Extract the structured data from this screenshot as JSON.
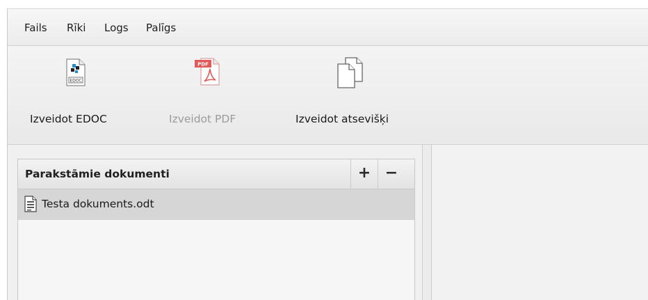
{
  "menu": {
    "items": [
      "Fails",
      "Rīki",
      "Logs",
      "Palīgs"
    ]
  },
  "toolbar": {
    "create_edoc": {
      "label": "Izveidot EDOC",
      "icon": "edoc-file-icon",
      "enabled": true
    },
    "create_pdf": {
      "label": "Izveidot PDF",
      "icon": "pdf-file-icon",
      "enabled": false,
      "icon_text": "PDF"
    },
    "create_separately": {
      "label": "Izveidot atsevišķi",
      "icon": "copy-documents-icon",
      "enabled": true
    },
    "edoc_icon_text": "EDOC"
  },
  "documents_panel": {
    "title": "Parakstāmie dokumenti",
    "add_label": "+",
    "remove_label": "−",
    "items": [
      {
        "name": "Testa dokuments.odt",
        "icon": "document-file-icon",
        "selected": true
      }
    ]
  },
  "colors": {
    "pdf_red": "#e05a5a",
    "selected_row": "#d6d6d6",
    "disabled_text": "#9a9a9a"
  }
}
